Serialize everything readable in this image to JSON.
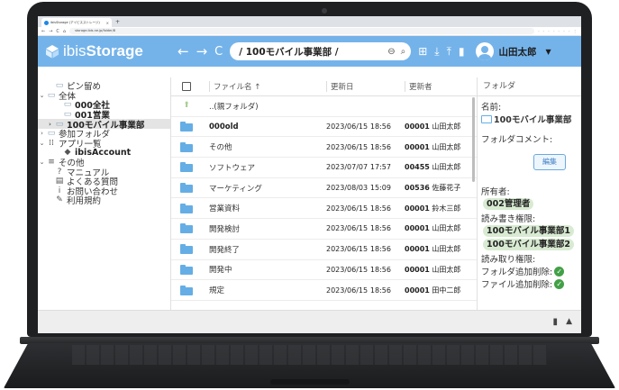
{
  "browser": {
    "tab_title": "ibisStorage (アイビスストレージ)",
    "url": "storage.ibis.ne.jp/folder/8"
  },
  "header": {
    "logo_pre": "ibis",
    "logo_bold": "Storage",
    "path": "/ 100モバイル事業部 /",
    "user_name": "山田太郎"
  },
  "tree": [
    {
      "label": "ピン留め",
      "icon": "pin-folder-icon",
      "arrow": "",
      "indent": 1,
      "bold": false,
      "selected": false
    },
    {
      "label": "全体",
      "icon": "folder-icon",
      "arrow": "v",
      "indent": 0,
      "bold": false,
      "selected": false
    },
    {
      "label": "000全社",
      "icon": "folder-icon",
      "arrow": "",
      "indent": 2,
      "bold": true,
      "selected": false
    },
    {
      "label": "001営業",
      "icon": "folder-icon",
      "arrow": "",
      "indent": 2,
      "bold": true,
      "selected": false
    },
    {
      "label": "100モバイル事業部",
      "icon": "folder-icon",
      "arrow": ">",
      "indent": 1,
      "bold": true,
      "selected": true
    },
    {
      "label": "参加フォルダ",
      "icon": "folder-icon",
      "arrow": ">",
      "indent": 0,
      "bold": false,
      "selected": false
    },
    {
      "label": "アプリ一覧",
      "icon": "apps-icon",
      "arrow": "v",
      "indent": 0,
      "bold": false,
      "selected": false
    },
    {
      "label": "ibisAccount",
      "icon": "account-icon",
      "arrow": "",
      "indent": 2,
      "bold": true,
      "selected": false
    },
    {
      "label": "その他",
      "icon": "menu-icon",
      "arrow": "v",
      "indent": 0,
      "bold": false,
      "selected": false
    },
    {
      "label": "マニュアル",
      "icon": "help-icon",
      "arrow": "",
      "indent": 1,
      "bold": false,
      "selected": false
    },
    {
      "label": "よくある質問",
      "icon": "faq-icon",
      "arrow": "",
      "indent": 1,
      "bold": false,
      "selected": false
    },
    {
      "label": "お問い合わせ",
      "icon": "info-icon",
      "arrow": "",
      "indent": 1,
      "bold": false,
      "selected": false
    },
    {
      "label": "利用規約",
      "icon": "terms-icon",
      "arrow": "",
      "indent": 1,
      "bold": false,
      "selected": false
    }
  ],
  "list": {
    "col_name": "ファイル名 ↑",
    "col_date": "更新日",
    "col_user": "更新者",
    "rows": [
      {
        "name": "..(親フォルダ)",
        "date": "",
        "time": "",
        "user_id": "",
        "user_name": "",
        "parent": true,
        "bold": false
      },
      {
        "name": "000old",
        "date": "2023/06/15",
        "time": "18:56",
        "user_id": "00001",
        "user_name": "山田太郎",
        "parent": false,
        "bold": true
      },
      {
        "name": "その他",
        "date": "2023/06/15",
        "time": "18:56",
        "user_id": "00001",
        "user_name": "山田太郎",
        "parent": false,
        "bold": false
      },
      {
        "name": "ソフトウェア",
        "date": "2023/07/07",
        "time": "17:57",
        "user_id": "00455",
        "user_name": "山田太郎",
        "parent": false,
        "bold": false
      },
      {
        "name": "マーケティング",
        "date": "2023/08/03",
        "time": "15:09",
        "user_id": "00536",
        "user_name": "佐藤花子",
        "parent": false,
        "bold": false
      },
      {
        "name": "営業資料",
        "date": "2023/06/15",
        "time": "18:56",
        "user_id": "00001",
        "user_name": "鈴木三郎",
        "parent": false,
        "bold": false
      },
      {
        "name": "開発検討",
        "date": "2023/06/15",
        "time": "18:56",
        "user_id": "00001",
        "user_name": "山田太郎",
        "parent": false,
        "bold": false
      },
      {
        "name": "開発終了",
        "date": "2023/06/15",
        "time": "18:56",
        "user_id": "00001",
        "user_name": "山田太郎",
        "parent": false,
        "bold": false
      },
      {
        "name": "開発中",
        "date": "2023/06/15",
        "time": "18:56",
        "user_id": "00001",
        "user_name": "山田太郎",
        "parent": false,
        "bold": false
      },
      {
        "name": "規定",
        "date": "2023/06/15",
        "time": "18:56",
        "user_id": "00001",
        "user_name": "田中二郎",
        "parent": false,
        "bold": false
      }
    ]
  },
  "props": {
    "title": "フォルダ",
    "name_label": "名前:",
    "name_value": "100モバイル事業部",
    "comment_label": "フォルダコメント:",
    "edit_label": "編集",
    "owner_label": "所有者:",
    "owner_value": "002管理者",
    "rw_label": "読み書き権限:",
    "rw_values": [
      "100モバイル事業部1",
      "100モバイル事業部2"
    ],
    "read_label": "読み取り権限:",
    "perm_folder_add": "フォルダ追加削除:",
    "perm_file_add": "ファイル追加削除:"
  },
  "colors": {
    "header_bg": "#74b3ea",
    "folder_blue": "#65aee5",
    "chip_green": "#d8ebd2",
    "ok_green": "#43a047"
  }
}
